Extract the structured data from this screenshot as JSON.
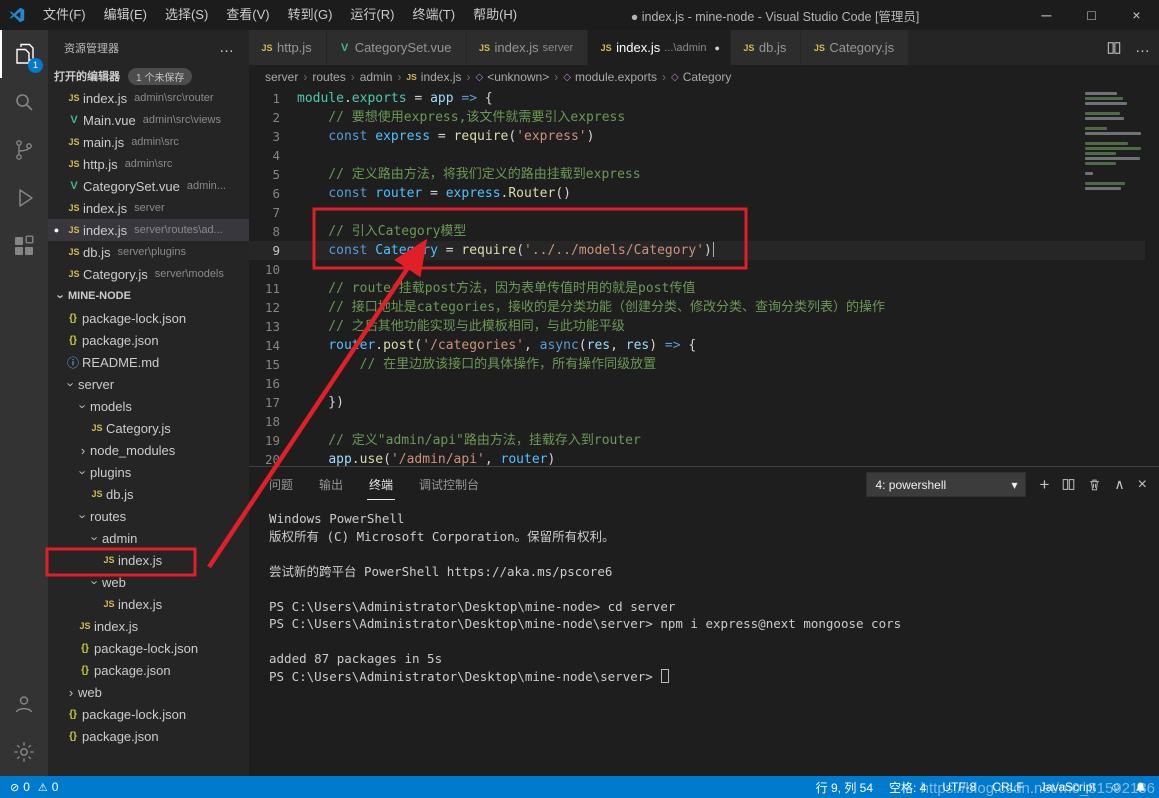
{
  "icons": {
    "js": "JS",
    "vue": "V",
    "json": "{}",
    "info": "ⓘ",
    "chevron": "›",
    "modified_dot": "●",
    "minimize": "─",
    "maximize": "□",
    "close": "×",
    "more": "…",
    "breadcrumb_sep": "›",
    "symbol": "◇",
    "dropdown": "▾",
    "plus": "+",
    "chevron_up": "∧",
    "error": "⊘",
    "warning": "⚠",
    "smiley": "☺"
  },
  "colors": {
    "accent": "#007acc",
    "annotation": "#e01f26"
  },
  "titlebar": {
    "menus": [
      "文件(F)",
      "编辑(E)",
      "选择(S)",
      "查看(V)",
      "转到(G)",
      "运行(R)",
      "终端(T)",
      "帮助(H)"
    ],
    "title": "● index.js - mine-node - Visual Studio Code [管理员]"
  },
  "activitybar": {
    "badge": "1"
  },
  "sidebar": {
    "title": "资源管理器",
    "open_editors_label": "打开的编辑器",
    "open_editors_badge": "1 个未保存",
    "open_editors": [
      {
        "icon": "js",
        "name": "index.js",
        "path": "admin\\src\\router"
      },
      {
        "icon": "vue",
        "name": "Main.vue",
        "path": "admin\\src\\views"
      },
      {
        "icon": "js",
        "name": "main.js",
        "path": "admin\\src"
      },
      {
        "icon": "js",
        "name": "http.js",
        "path": "admin\\src"
      },
      {
        "icon": "vue",
        "name": "CategorySet.vue",
        "path": "admin..."
      },
      {
        "icon": "js",
        "name": "index.js",
        "path": "server"
      },
      {
        "icon": "js",
        "name": "index.js",
        "path": "server\\routes\\ad...",
        "selected": true,
        "modified": true
      },
      {
        "icon": "js",
        "name": "db.js",
        "path": "server\\plugins"
      },
      {
        "icon": "js",
        "name": "Category.js",
        "path": "server\\models"
      }
    ],
    "root_label": "MINE-NODE",
    "tree": [
      {
        "icon": "json",
        "label": "package-lock.json",
        "indent": 1
      },
      {
        "icon": "json",
        "label": "package.json",
        "indent": 1
      },
      {
        "icon": "info",
        "label": "README.md",
        "indent": 1
      },
      {
        "chevron": "down",
        "label": "server",
        "indent": 1
      },
      {
        "chevron": "down",
        "label": "models",
        "indent": 2
      },
      {
        "icon": "js",
        "label": "Category.js",
        "indent": 3
      },
      {
        "chevron": "right",
        "label": "node_modules",
        "indent": 2
      },
      {
        "chevron": "down",
        "label": "plugins",
        "indent": 2
      },
      {
        "icon": "js",
        "label": "db.js",
        "indent": 3
      },
      {
        "chevron": "down",
        "label": "routes",
        "indent": 2
      },
      {
        "chevron": "down",
        "label": "admin",
        "indent": 3
      },
      {
        "icon": "js",
        "label": "index.js",
        "indent": 4,
        "boxed": true
      },
      {
        "chevron": "down",
        "label": "web",
        "indent": 3
      },
      {
        "icon": "js",
        "label": "index.js",
        "indent": 4
      },
      {
        "icon": "js",
        "label": "index.js",
        "indent": 2
      },
      {
        "icon": "json",
        "label": "package-lock.json",
        "indent": 2
      },
      {
        "icon": "json",
        "label": "package.json",
        "indent": 2
      },
      {
        "chevron": "right",
        "label": "web",
        "indent": 1
      },
      {
        "icon": "json",
        "label": "package-lock.json",
        "indent": 1
      },
      {
        "icon": "json",
        "label": "package.json",
        "indent": 1
      }
    ]
  },
  "tabs": [
    {
      "icon": "js",
      "label": "http.js"
    },
    {
      "icon": "vue",
      "label": "CategorySet.vue"
    },
    {
      "icon": "js",
      "label": "index.js",
      "detail": "server"
    },
    {
      "icon": "js",
      "label": "index.js",
      "detail": "...\\admin",
      "active": true,
      "modified": true
    },
    {
      "icon": "js",
      "label": "db.js"
    },
    {
      "icon": "js",
      "label": "Category.js"
    }
  ],
  "breadcrumb": [
    {
      "label": "server"
    },
    {
      "label": "routes"
    },
    {
      "label": "admin"
    },
    {
      "label": "index.js",
      "icon": "js"
    },
    {
      "label": "<unknown>",
      "icon": "symbol"
    },
    {
      "label": "module.exports",
      "icon": "symbol"
    },
    {
      "label": "Category",
      "icon": "symbol"
    }
  ],
  "editor": {
    "current_line": 9,
    "cursor_col": 54,
    "lines": [
      [
        [
          "cls",
          "module"
        ],
        [
          "pl",
          "."
        ],
        [
          "cls",
          "exports"
        ],
        [
          "pl",
          " = "
        ],
        [
          "var",
          "app"
        ],
        [
          "pl",
          " "
        ],
        [
          "kw",
          "=>"
        ],
        [
          "pl",
          " {"
        ]
      ],
      [
        [
          "cm",
          "    // 要想使用express,该文件就需要引入express"
        ]
      ],
      [
        [
          "pl",
          "    "
        ],
        [
          "kw",
          "const"
        ],
        [
          "pl",
          " "
        ],
        [
          "cnst",
          "express"
        ],
        [
          "pl",
          " = "
        ],
        [
          "fn",
          "require"
        ],
        [
          "pl",
          "("
        ],
        [
          "str",
          "'express'"
        ],
        [
          "pl",
          ")"
        ]
      ],
      [],
      [
        [
          "cm",
          "    // 定义路由方法，将我们定义的路由挂载到express"
        ]
      ],
      [
        [
          "pl",
          "    "
        ],
        [
          "kw",
          "const"
        ],
        [
          "pl",
          " "
        ],
        [
          "cnst",
          "router"
        ],
        [
          "pl",
          " = "
        ],
        [
          "cnst",
          "express"
        ],
        [
          "pl",
          "."
        ],
        [
          "fn",
          "Router"
        ],
        [
          "pl",
          "()"
        ]
      ],
      [],
      [
        [
          "cm",
          "    // 引入Category模型"
        ]
      ],
      [
        [
          "pl",
          "    "
        ],
        [
          "kw",
          "const"
        ],
        [
          "pl",
          " "
        ],
        [
          "cnst",
          "Category"
        ],
        [
          "pl",
          " = "
        ],
        [
          "fn",
          "require"
        ],
        [
          "pl",
          "("
        ],
        [
          "str",
          "'../../models/Category'"
        ],
        [
          "pl",
          ")"
        ]
      ],
      [],
      [
        [
          "cm",
          "    // router挂载post方法，因为表单传值时用的就是post传值"
        ]
      ],
      [
        [
          "cm",
          "    // 接口地址是categories，接收的是分类功能（创建分类、修改分类、查询分类列表）的操作"
        ]
      ],
      [
        [
          "cm",
          "    // 之后其他功能实现与此模板相同，与此功能平级"
        ]
      ],
      [
        [
          "pl",
          "    "
        ],
        [
          "cnst",
          "router"
        ],
        [
          "pl",
          "."
        ],
        [
          "fn",
          "post"
        ],
        [
          "pl",
          "("
        ],
        [
          "str",
          "'/categories'"
        ],
        [
          "pl",
          ", "
        ],
        [
          "kw",
          "async"
        ],
        [
          "pl",
          "("
        ],
        [
          "var",
          "res"
        ],
        [
          "pl",
          ", "
        ],
        [
          "var",
          "res"
        ],
        [
          "pl",
          ") "
        ],
        [
          "kw",
          "=>"
        ],
        [
          "pl",
          " {"
        ]
      ],
      [
        [
          "cm",
          "        // 在里边放该接口的具体操作，所有操作同级放置"
        ]
      ],
      [],
      [
        [
          "pl",
          "    })"
        ]
      ],
      [],
      [
        [
          "cm",
          "    // 定义\"admin/api\"路由方法，挂载存入到router"
        ]
      ],
      [
        [
          "pl",
          "    "
        ],
        [
          "var",
          "app"
        ],
        [
          "pl",
          "."
        ],
        [
          "fn",
          "use"
        ],
        [
          "pl",
          "("
        ],
        [
          "str",
          "'/admin/api'"
        ],
        [
          "pl",
          ", "
        ],
        [
          "cnst",
          "router"
        ],
        [
          "pl",
          ")"
        ]
      ]
    ]
  },
  "panel": {
    "tabs": [
      {
        "label": "问题"
      },
      {
        "label": "输出"
      },
      {
        "label": "终端",
        "active": true
      },
      {
        "label": "调试控制台"
      }
    ],
    "shell_select": "4: powershell",
    "terminal_lines": [
      "Windows PowerShell",
      "版权所有 (C) Microsoft Corporation。保留所有权利。",
      "",
      "尝试新的跨平台 PowerShell https://aka.ms/pscore6",
      "",
      "PS C:\\Users\\Administrator\\Desktop\\mine-node> cd server",
      "PS C:\\Users\\Administrator\\Desktop\\mine-node\\server> npm i express@next mongoose cors",
      "",
      "added 87 packages in 5s",
      "PS C:\\Users\\Administrator\\Desktop\\mine-node\\server> "
    ]
  },
  "statusbar": {
    "errors": "0",
    "warnings": "0",
    "items": [
      "行 9, 列 54",
      "空格: 4",
      "UTF-8",
      "CRLF",
      "JavaScript"
    ]
  },
  "watermark": "https://blog.csdn.net/m0_51592186"
}
